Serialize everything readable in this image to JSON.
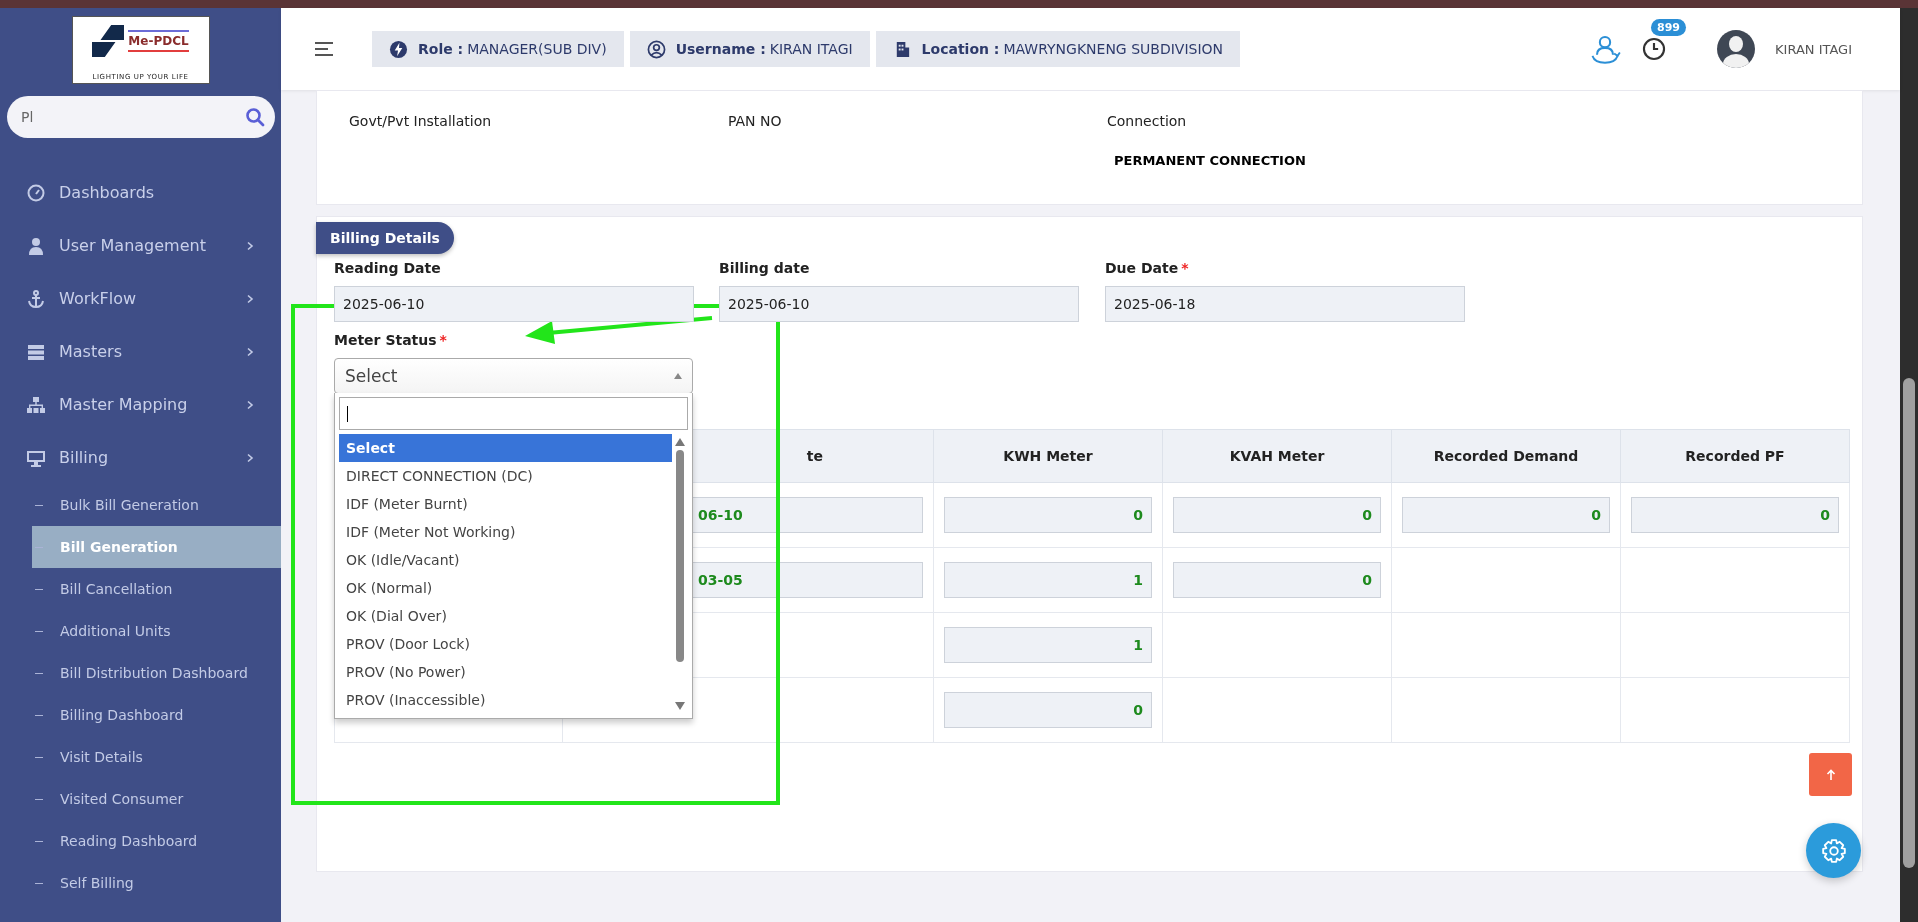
{
  "logo": {
    "title": "Me-PDCL",
    "tagline": "LIGHTING UP YOUR LIFE"
  },
  "sidebar": {
    "search": {
      "value": "Pl"
    },
    "items": [
      {
        "label": "Dashboards",
        "expandable": false
      },
      {
        "label": "User Management",
        "expandable": true
      },
      {
        "label": "WorkFlow",
        "expandable": true
      },
      {
        "label": "Masters",
        "expandable": true
      },
      {
        "label": "Master Mapping",
        "expandable": true
      },
      {
        "label": "Billing",
        "expandable": true,
        "children": [
          {
            "label": "Bulk Bill Generation",
            "selected": false
          },
          {
            "label": "Bill Generation",
            "selected": true
          },
          {
            "label": "Bill Cancellation",
            "selected": false
          },
          {
            "label": "Additional Units",
            "selected": false
          },
          {
            "label": "Bill Distribution Dashboard",
            "selected": false
          },
          {
            "label": "Billing Dashboard",
            "selected": false
          },
          {
            "label": "Visit Details",
            "selected": false
          },
          {
            "label": "Visited Consumer",
            "selected": false
          },
          {
            "label": "Reading Dashboard",
            "selected": false
          },
          {
            "label": "Self Billing",
            "selected": false
          }
        ]
      }
    ]
  },
  "header": {
    "chips": [
      {
        "kind": "role",
        "label": "Role :",
        "value": "MANAGER(SUB DIV)"
      },
      {
        "kind": "user",
        "label": "Username :",
        "value": "KIRAN ITAGI"
      },
      {
        "kind": "location",
        "label": "Location :",
        "value": "MAWRYNGKNENG SUBDIVISION"
      }
    ],
    "notification_count": "899",
    "user_name": "KIRAN ITAGI"
  },
  "connection_card": {
    "fields": [
      {
        "label": "Govt/Pvt Installation"
      },
      {
        "label": "PAN NO"
      },
      {
        "label": "Connection",
        "value": "PERMANENT CONNECTION"
      }
    ]
  },
  "billing": {
    "title": "Billing Details",
    "fields": [
      {
        "label": "Reading Date",
        "value": "2025-06-10"
      },
      {
        "label": "Billing date",
        "value": "2025-06-10"
      },
      {
        "label": "Due Date",
        "value": "2025-06-18",
        "required_mark": "*"
      }
    ],
    "meter_status": {
      "label": "Meter Status",
      "required_mark": "*",
      "value": "Select",
      "options": [
        {
          "label": "Select",
          "selected": true
        },
        {
          "label": "DIRECT CONNECTION (DC)",
          "selected": false
        },
        {
          "label": "IDF (Meter Burnt)",
          "selected": false
        },
        {
          "label": "IDF (Meter Not Working)",
          "selected": false
        },
        {
          "label": "OK (Idle/Vacant)",
          "selected": false
        },
        {
          "label": "OK (Normal)",
          "selected": false
        },
        {
          "label": "OK (Dial Over)",
          "selected": false
        },
        {
          "label": "PROV (Door Lock)",
          "selected": false
        },
        {
          "label": "PROV (No Power)",
          "selected": false
        },
        {
          "label": "PROV (Inaccessible)",
          "selected": false
        }
      ]
    },
    "table": {
      "columns": [
        "te",
        "KWH Meter",
        "KVAH Meter",
        "Recorded Demand",
        "Recorded PF"
      ],
      "rows": [
        [
          "06-10",
          "0",
          "0",
          "0",
          "0"
        ],
        [
          "03-05",
          "1",
          "0",
          null,
          null
        ],
        [
          null,
          "1",
          null,
          null,
          null
        ],
        [
          null,
          "0",
          null,
          null,
          null
        ]
      ]
    }
  }
}
